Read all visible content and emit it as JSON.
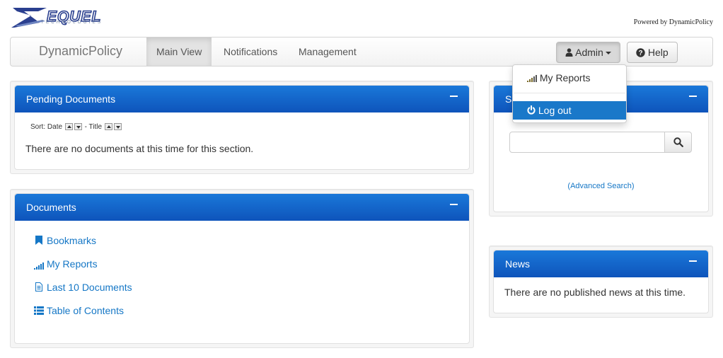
{
  "header": {
    "logo_text": "ZEQUEL",
    "logo_subtext": "TECHNOLOGIES",
    "powered_by": "Powered by DynamicPolicy"
  },
  "navbar": {
    "brand": "DynamicPolicy",
    "items": [
      {
        "label": "Main View",
        "active": true
      },
      {
        "label": "Notifications",
        "active": false
      },
      {
        "label": "Management",
        "active": false
      }
    ],
    "admin_label": "Admin",
    "help_label": "Help"
  },
  "admin_menu": {
    "items": [
      {
        "label": "My Reports",
        "icon": "signal-bars-icon",
        "highlighted": false
      },
      {
        "label": "Log out",
        "icon": "power-icon",
        "highlighted": true
      }
    ]
  },
  "pending_documents": {
    "title": "Pending Documents",
    "sort_label": "Sort:",
    "sort_date": "Date",
    "sort_separator": "-",
    "sort_title": "Title",
    "empty_message": "There are no documents at this time for this section."
  },
  "documents": {
    "title": "Documents",
    "links": [
      {
        "label": "Bookmarks",
        "icon": "bookmark-icon"
      },
      {
        "label": "My Reports",
        "icon": "signal-bars-icon"
      },
      {
        "label": "Last 10 Documents",
        "icon": "document-icon"
      },
      {
        "label": "Table of Contents",
        "icon": "list-icon"
      }
    ]
  },
  "search": {
    "title": "Search",
    "query": "",
    "advanced_link": "(Advanced Search)"
  },
  "news": {
    "title": "News",
    "empty_message": "There are no published news at this time."
  },
  "colors": {
    "panel_header_top": "#1a78d9",
    "panel_header_bottom": "#0e54bb",
    "link": "#1577c6",
    "dropdown_highlight": "#1a78c9"
  }
}
